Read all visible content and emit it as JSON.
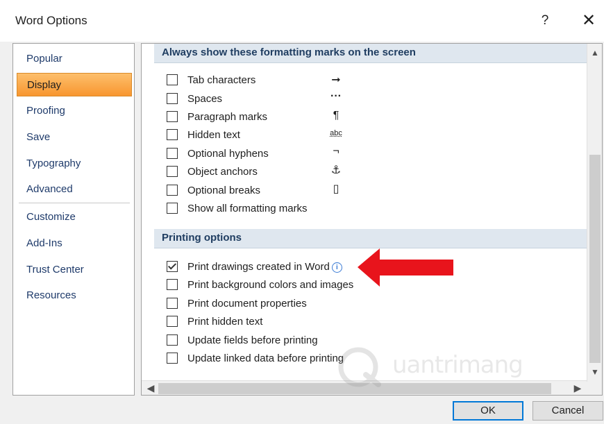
{
  "window": {
    "title": "Word Options",
    "help_label": "?",
    "close_label": "✕"
  },
  "sidebar": {
    "items": [
      {
        "label": "Popular"
      },
      {
        "label": "Display",
        "selected": true
      },
      {
        "label": "Proofing"
      },
      {
        "label": "Save"
      },
      {
        "label": "Typography"
      },
      {
        "label": "Advanced"
      },
      {
        "label": "Customize"
      },
      {
        "label": "Add-Ins"
      },
      {
        "label": "Trust Center"
      },
      {
        "label": "Resources"
      }
    ]
  },
  "formatting_marks": {
    "header": "Always show these formatting marks on the screen",
    "options": [
      {
        "label": "Tab characters",
        "checked": false,
        "mark": "➞"
      },
      {
        "label": "Spaces",
        "checked": false,
        "mark": "···"
      },
      {
        "label": "Paragraph marks",
        "checked": false,
        "mark": "¶"
      },
      {
        "label": "Hidden text",
        "checked": false,
        "mark": "abc"
      },
      {
        "label": "Optional hyphens",
        "checked": false,
        "mark": "¬"
      },
      {
        "label": "Object anchors",
        "checked": false,
        "mark": "⚓"
      },
      {
        "label": "Optional breaks",
        "checked": false,
        "mark": "▯"
      },
      {
        "label": "Show all formatting marks",
        "checked": false
      }
    ]
  },
  "printing": {
    "header": "Printing options",
    "options": [
      {
        "label": "Print drawings created in Word",
        "checked": true,
        "info": "i"
      },
      {
        "label": "Print background colors and images",
        "checked": false
      },
      {
        "label": "Print document properties",
        "checked": false
      },
      {
        "label": "Print hidden text",
        "checked": false
      },
      {
        "label": "Update fields before printing",
        "checked": false
      },
      {
        "label": "Update linked data before printing",
        "checked": false
      }
    ]
  },
  "buttons": {
    "ok": "OK",
    "cancel": "Cancel"
  },
  "scroll": {
    "up": "▲",
    "down": "▼",
    "left": "◀",
    "right": "▶"
  },
  "watermark": {
    "text": "uantrimang"
  },
  "colors": {
    "selected_nav": "#f8962f",
    "section_header": "#dfe7ef",
    "annotation_arrow": "#e8141c",
    "ok_border": "#0078d7"
  }
}
